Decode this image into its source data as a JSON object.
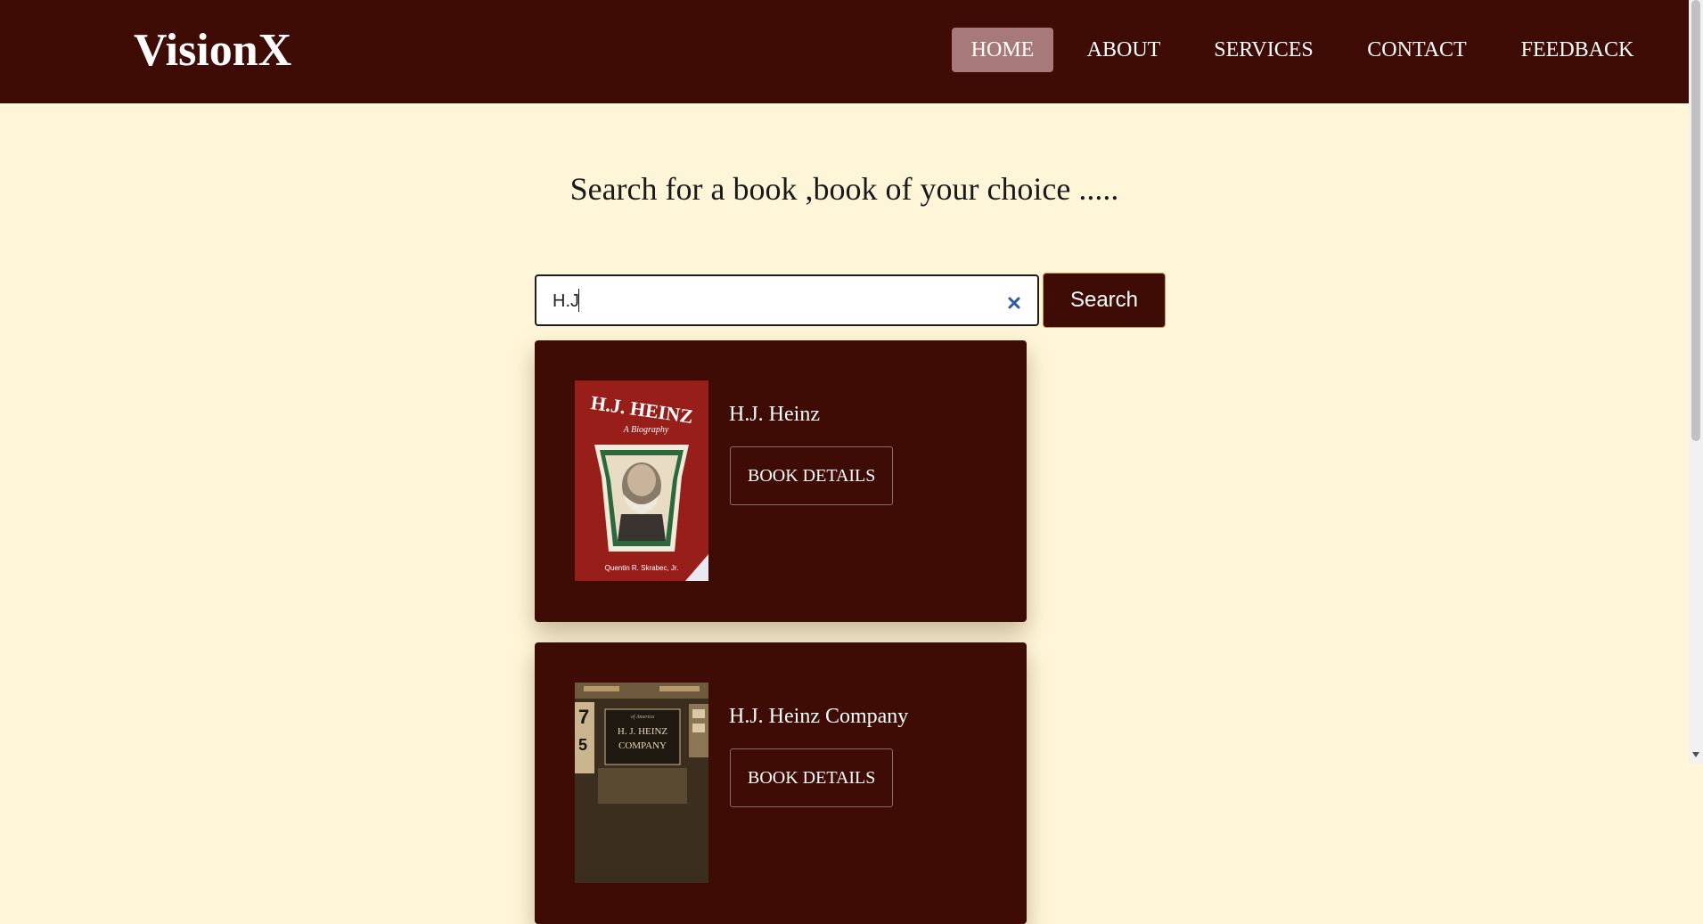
{
  "app": {
    "logo": "VisionX"
  },
  "nav": {
    "items": [
      {
        "label": "HOME",
        "active": true
      },
      {
        "label": "ABOUT",
        "active": false
      },
      {
        "label": "SERVICES",
        "active": false
      },
      {
        "label": "CONTACT",
        "active": false
      },
      {
        "label": "FEEDBACK",
        "active": false
      }
    ]
  },
  "main": {
    "headline": "Search for a book ,book of your choice .....",
    "search": {
      "value": "H.J",
      "placeholder": "",
      "button_label": "Search"
    }
  },
  "results": [
    {
      "title": "H.J. Heinz",
      "button_label": "BOOK DETAILS",
      "cover": {
        "title": "H.J. HEINZ",
        "subtitle": "A Biography",
        "author": "Quentin R. Skrabec, Jr."
      }
    },
    {
      "title": "H.J. Heinz Company",
      "button_label": "BOOK DETAILS",
      "cover": {
        "series": "of America",
        "title_line1": "H. J. HEINZ",
        "title_line2": "COMPANY"
      }
    }
  ],
  "colors": {
    "navbar": "#3e0c04",
    "page_bg": "#fff6d9",
    "nav_active": "#a77a79",
    "card_bg": "#3e0c04",
    "clear_icon": "#2d5aa0"
  }
}
